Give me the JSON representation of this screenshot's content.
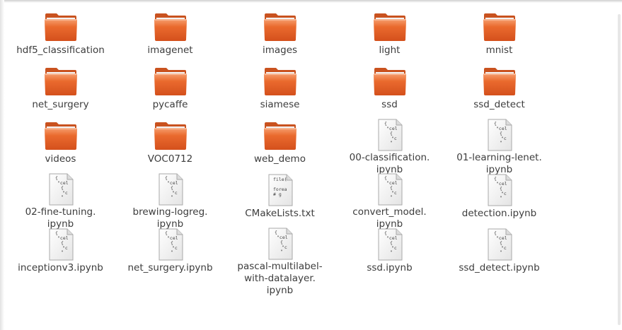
{
  "files": [
    {
      "lines": [
        "hdf5_classification"
      ],
      "type": "folder",
      "icon": "folder-icon"
    },
    {
      "lines": [
        "imagenet"
      ],
      "type": "folder",
      "icon": "folder-icon"
    },
    {
      "lines": [
        "images"
      ],
      "type": "folder",
      "icon": "folder-icon"
    },
    {
      "lines": [
        "light"
      ],
      "type": "folder",
      "icon": "folder-icon"
    },
    {
      "lines": [
        "mnist"
      ],
      "type": "folder",
      "icon": "folder-icon"
    },
    {
      "lines": [
        "net_surgery"
      ],
      "type": "folder",
      "icon": "folder-icon"
    },
    {
      "lines": [
        "pycaffe"
      ],
      "type": "folder",
      "icon": "folder-icon"
    },
    {
      "lines": [
        "siamese"
      ],
      "type": "folder",
      "icon": "folder-icon"
    },
    {
      "lines": [
        "ssd"
      ],
      "type": "folder",
      "icon": "folder-icon"
    },
    {
      "lines": [
        "ssd_detect"
      ],
      "type": "folder",
      "icon": "folder-icon"
    },
    {
      "lines": [
        "videos"
      ],
      "type": "folder",
      "icon": "folder-icon"
    },
    {
      "lines": [
        "VOC0712"
      ],
      "type": "folder",
      "icon": "folder-icon"
    },
    {
      "lines": [
        "web_demo"
      ],
      "type": "folder",
      "icon": "folder-icon"
    },
    {
      "lines": [
        "00-classification.",
        "ipynb"
      ],
      "type": "notebook",
      "icon": "notebook-file-icon"
    },
    {
      "lines": [
        "01-learning-lenet.",
        "ipynb"
      ],
      "type": "notebook",
      "icon": "notebook-file-icon"
    },
    {
      "lines": [
        "02-fine-tuning.",
        "ipynb"
      ],
      "type": "notebook",
      "icon": "notebook-file-icon"
    },
    {
      "lines": [
        "brewing-logreg.",
        "ipynb"
      ],
      "type": "notebook",
      "icon": "notebook-file-icon"
    },
    {
      "lines": [
        "CMakeLists.txt"
      ],
      "type": "text",
      "icon": "text-file-icon"
    },
    {
      "lines": [
        "convert_model.",
        "ipynb"
      ],
      "type": "notebook",
      "icon": "notebook-file-icon"
    },
    {
      "lines": [
        "detection.ipynb"
      ],
      "type": "notebook",
      "icon": "notebook-file-icon"
    },
    {
      "lines": [
        "inceptionv3.ipynb"
      ],
      "type": "notebook",
      "icon": "notebook-file-icon"
    },
    {
      "lines": [
        "net_surgery.ipynb"
      ],
      "type": "notebook",
      "icon": "notebook-file-icon"
    },
    {
      "lines": [
        "pascal-multilabel-",
        "with-datalayer.",
        "ipynb"
      ],
      "type": "notebook",
      "icon": "notebook-file-icon"
    },
    {
      "lines": [
        "ssd.ipynb"
      ],
      "type": "notebook",
      "icon": "notebook-file-icon"
    },
    {
      "lines": [
        "ssd_detect.ipynb"
      ],
      "type": "notebook",
      "icon": "notebook-file-icon"
    }
  ],
  "preview": {
    "notebook": [
      "{",
      "\"cel",
      "{",
      "\"c",
      "\""
    ],
    "text": [
      "file(",
      "",
      "forea",
      "# g"
    ]
  },
  "colors": {
    "folder_light": "#f6a070",
    "folder_mid": "#ea6a2e",
    "folder_dark": "#d4501c",
    "label": "#3c3c3c"
  }
}
